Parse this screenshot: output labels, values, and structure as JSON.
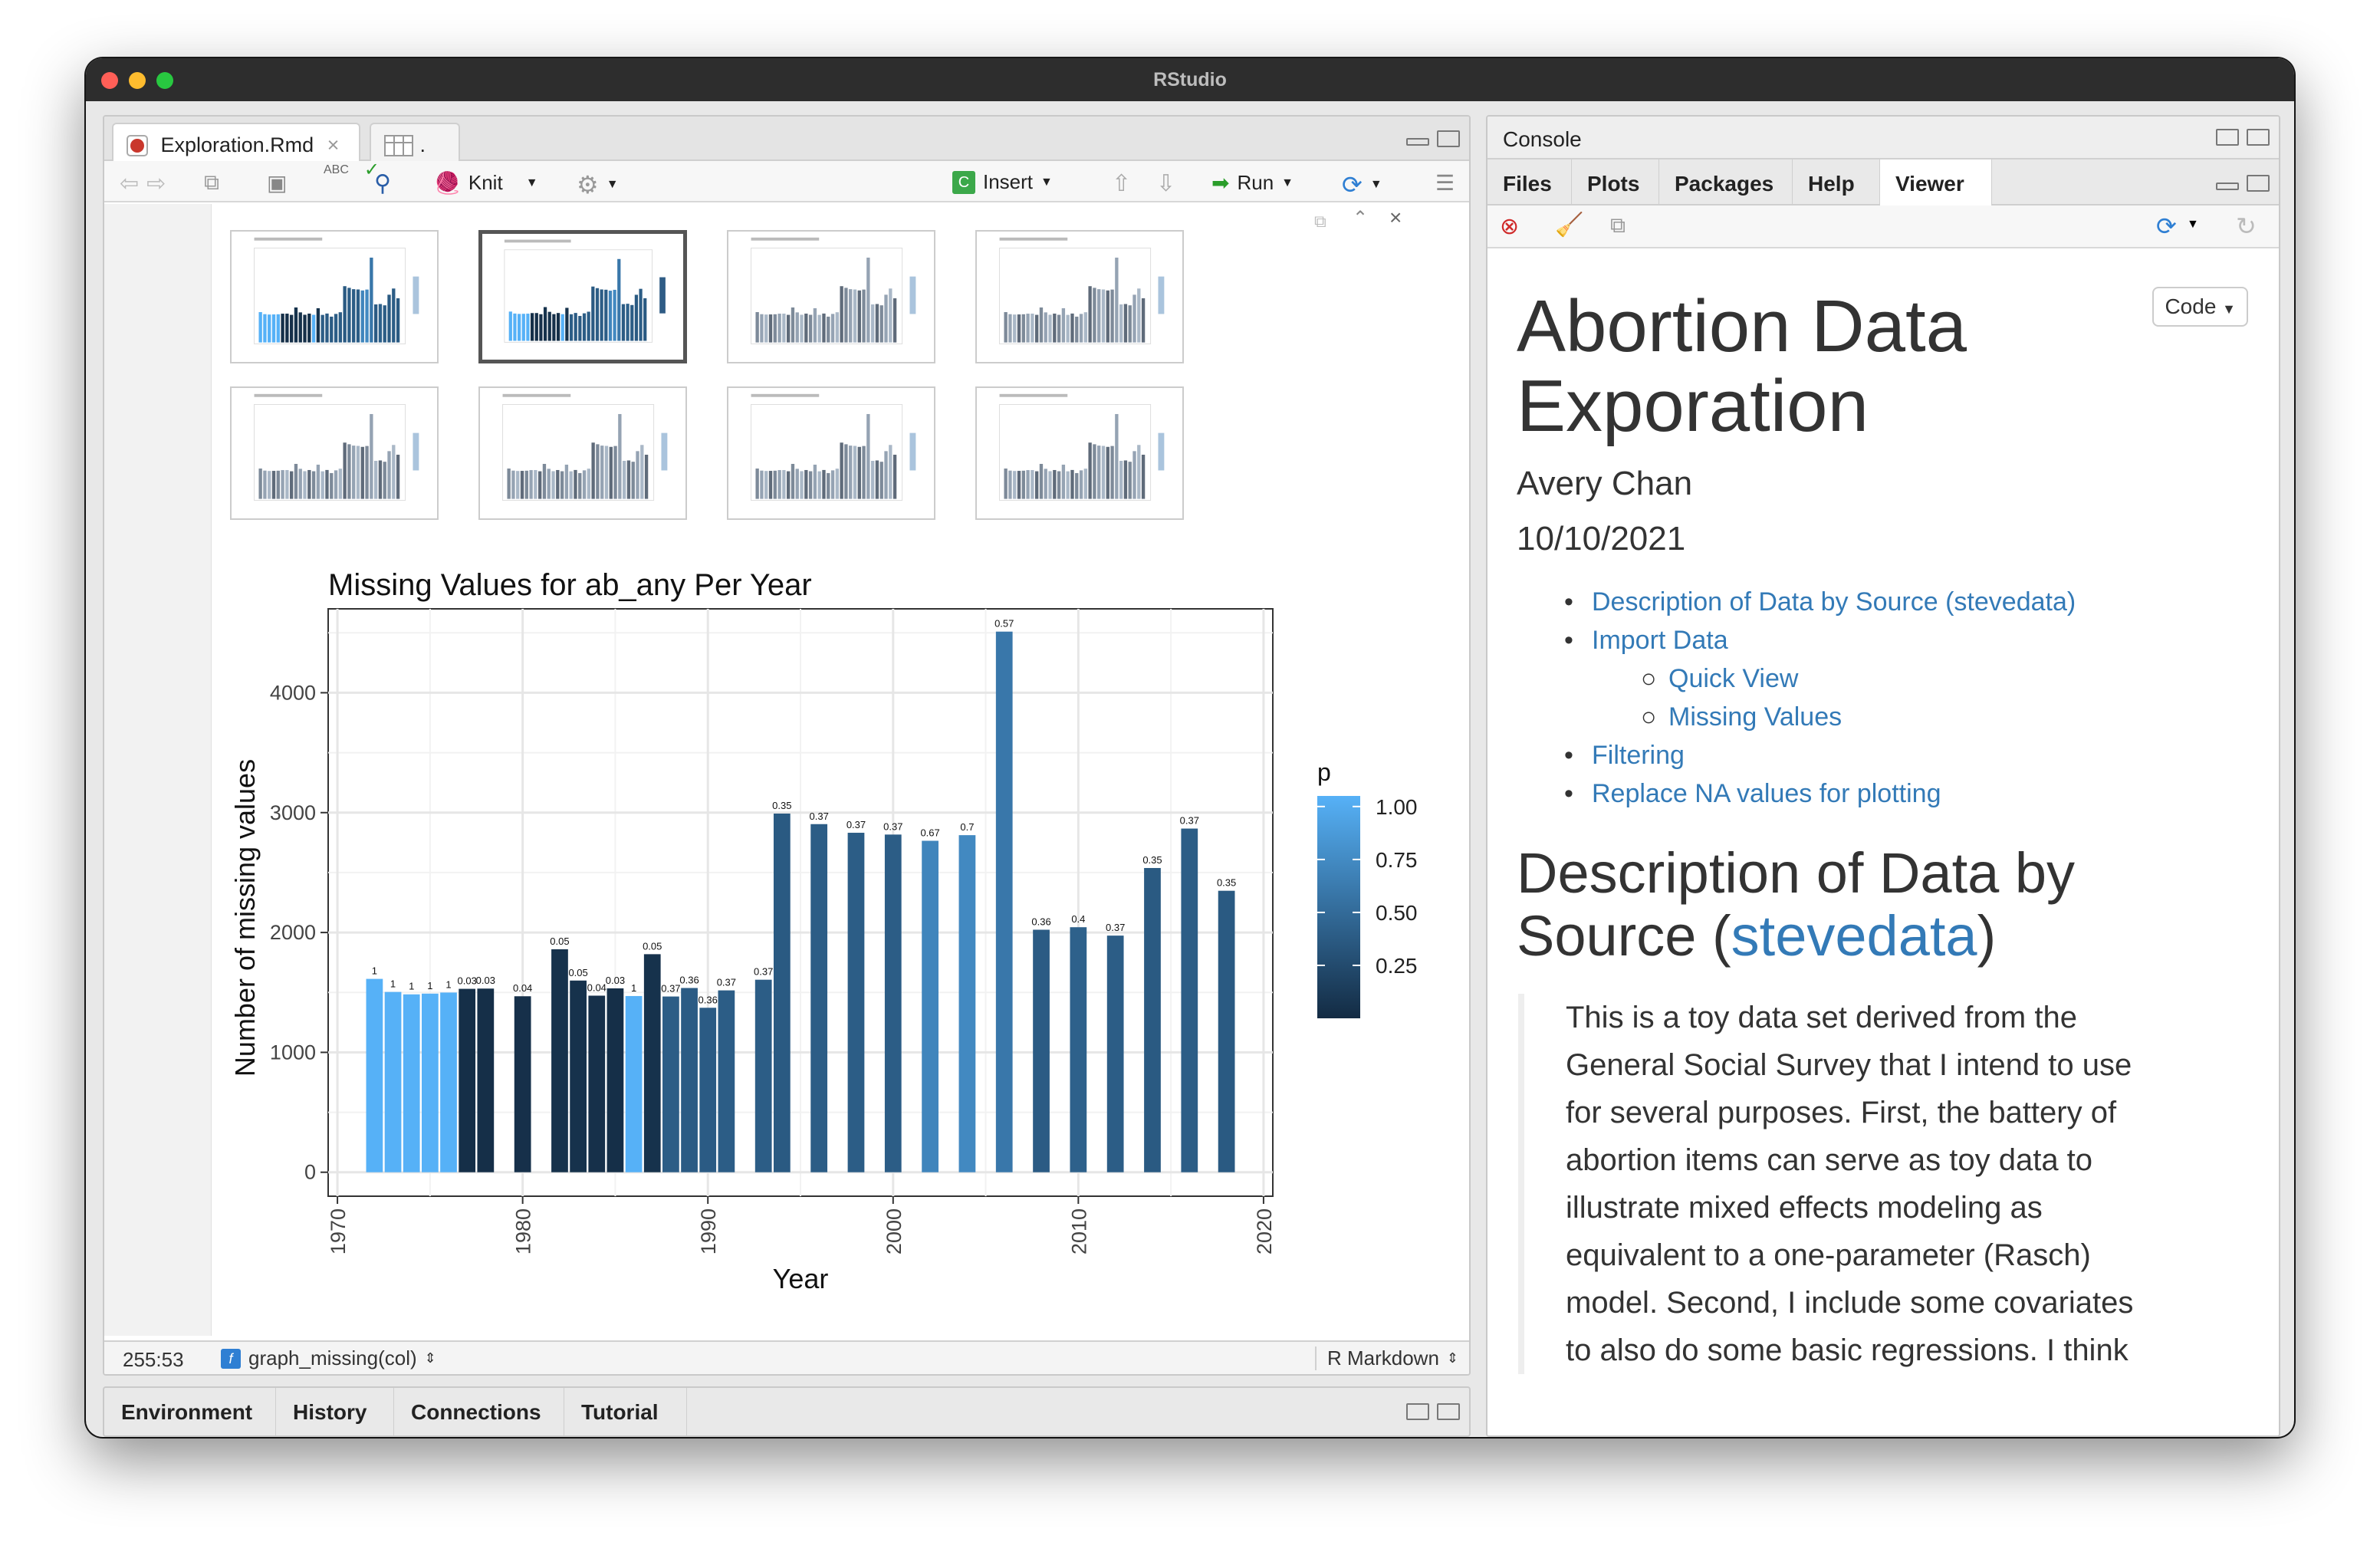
{
  "window": {
    "title": "RStudio"
  },
  "source": {
    "tabs": [
      {
        "label": "Exploration.Rmd",
        "active": true
      },
      {
        "label": "."
      }
    ],
    "toolbar": {
      "spell": "ABC",
      "knit": "Knit",
      "insert": "Insert",
      "run": "Run"
    },
    "status": {
      "position": "255:53",
      "function": "graph_missing(col)",
      "mode": "R Markdown"
    }
  },
  "bottom_tabs": [
    "Environment",
    "History",
    "Connections",
    "Tutorial"
  ],
  "console": {
    "label": "Console"
  },
  "viewer_tabs": [
    "Files",
    "Plots",
    "Packages",
    "Help",
    "Viewer"
  ],
  "viewer": {
    "code_button": "Code",
    "title_line1": "Abortion Data",
    "title_line2": "Exporation",
    "author": "Avery Chan",
    "date": "10/10/2021",
    "toc": [
      {
        "label": "Description of Data by Source (stevedata)",
        "level": 1
      },
      {
        "label": "Import Data",
        "level": 1
      },
      {
        "label": "Quick View",
        "level": 2
      },
      {
        "label": "Missing Values",
        "level": 2
      },
      {
        "label": "Filtering",
        "level": 1
      },
      {
        "label": "Replace NA values for plotting",
        "level": 1
      }
    ],
    "h2_pre": "Description of Data by Source (",
    "h2_link": "stevedata",
    "h2_post": ")",
    "quote_lines": [
      "This is a toy data set derived from the",
      "General Social Survey that I intend to use",
      "for several purposes. First, the battery of",
      "abortion items can serve as toy data to",
      "illustrate mixed effects modeling as",
      "equivalent to a one-parameter (Rasch)",
      "model. Second, I include some covariates",
      "to also do some basic regressions. I think"
    ]
  },
  "colors": {
    "accent_link": "#337ab7",
    "low": "#132b43",
    "high": "#56b1f7"
  },
  "chart_data": {
    "type": "bar",
    "title": "Missing Values for  ab_any  Per Year",
    "xlabel": "Year",
    "ylabel": "Number of missing values",
    "xlim": [
      1969.5,
      2020.5
    ],
    "ylim": [
      -200,
      4700
    ],
    "xticks": [
      1970,
      1980,
      1990,
      2000,
      2010,
      2020
    ],
    "yticks": [
      0,
      1000,
      2000,
      3000,
      4000
    ],
    "legend": {
      "title": "p",
      "ticks": [
        "1.00",
        "0.75",
        "0.50",
        "0.25"
      ],
      "tick_values": [
        1.0,
        0.75,
        0.5,
        0.25
      ],
      "range": [
        0,
        1.05
      ],
      "placement": "right"
    },
    "x": [
      1972,
      1973,
      1974,
      1975,
      1976,
      1977,
      1978,
      1980,
      1982,
      1983,
      1984,
      1985,
      1986,
      1987,
      1988,
      1989,
      1990,
      1991,
      1993,
      1994,
      1996,
      1998,
      2000,
      2002,
      2004,
      2006,
      2008,
      2010,
      2012,
      2014,
      2016,
      2018
    ],
    "values": [
      1613,
      1504,
      1484,
      1490,
      1499,
      1530,
      1532,
      1468,
      1860,
      1599,
      1473,
      1534,
      1470,
      1819,
      1466,
      1537,
      1372,
      1517,
      1606,
      2992,
      2904,
      2832,
      2817,
      2765,
      2812,
      4510,
      2023,
      2044,
      1974,
      2538,
      2867,
      2348
    ],
    "p": [
      1,
      1,
      1,
      1,
      1,
      0.03,
      0.03,
      0.04,
      0.05,
      0.05,
      0.04,
      0.03,
      1,
      0.05,
      0.37,
      0.36,
      0.36,
      0.37,
      0.37,
      0.35,
      0.37,
      0.37,
      0.37,
      0.67,
      0.7,
      0.57,
      0.36,
      0.4,
      0.37,
      0.35,
      0.37,
      0.35
    ],
    "labels": [
      "1",
      "1",
      "1",
      "1",
      "1",
      "0.03",
      "0.03",
      "0.04",
      "0.05",
      "0.05",
      "0.04",
      "0.03",
      "1",
      "0.05",
      "0.37",
      "0.36",
      "0.36",
      "0.37",
      "0.37",
      "0.35",
      "0.37",
      "0.37",
      "0.37",
      "0.67",
      "0.7",
      "0.57",
      "0.36",
      "0.4",
      "0.37",
      "0.35",
      "0.37",
      "0.35"
    ]
  }
}
